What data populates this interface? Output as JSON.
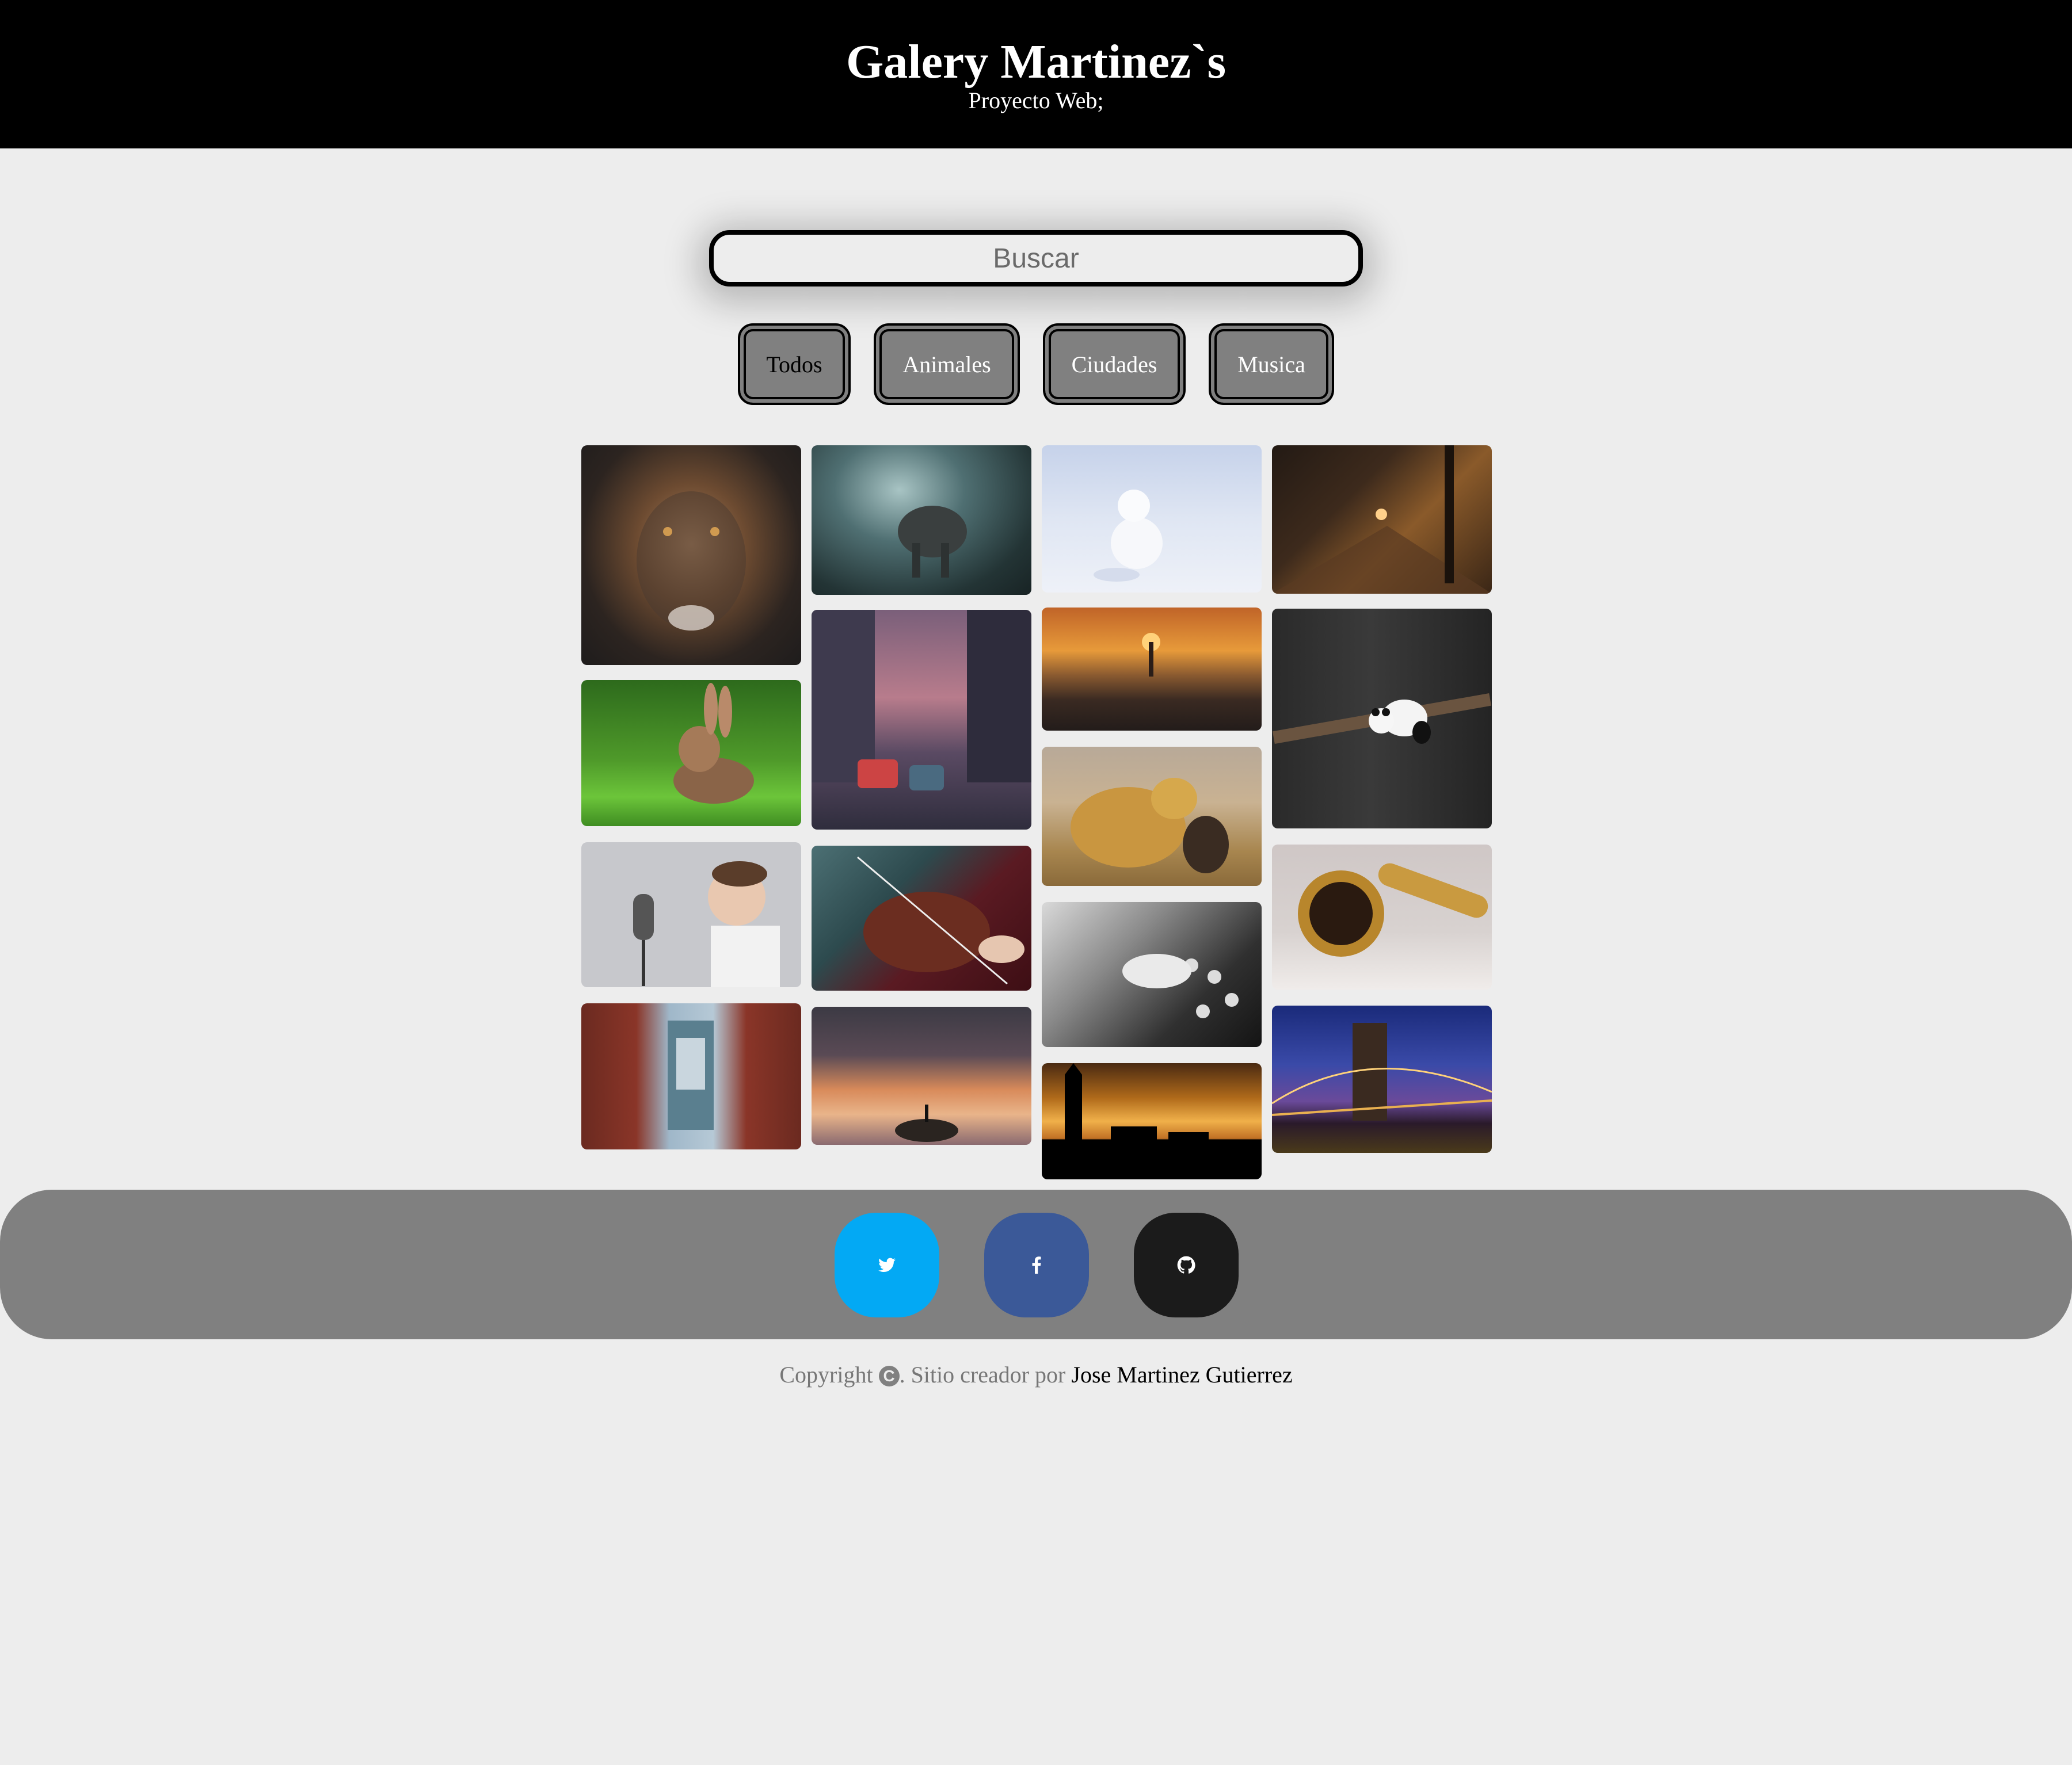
{
  "header": {
    "title": "Galery Martinez`s",
    "subtitle": "Proyecto Web;"
  },
  "search": {
    "placeholder": "Buscar"
  },
  "filters": [
    {
      "label": "Todos",
      "active": true
    },
    {
      "label": "Animales"
    },
    {
      "label": "Ciudades"
    },
    {
      "label": "Musica"
    }
  ],
  "gallery": {
    "columns": [
      [
        "lion",
        "rabbit",
        "boy-singing",
        "manhattan-bridge"
      ],
      [
        "elephant-forest",
        "city-traffic",
        "violin",
        "inverted-city-sunset"
      ],
      [
        "arctic-fox",
        "city-sunset-aerial",
        "lion-and-girl",
        "dj-mixer",
        "london-skyline-sunset"
      ],
      [
        "night-street",
        "panda",
        "saxophone",
        "brooklyn-bridge-night"
      ]
    ]
  },
  "social": [
    {
      "icon": "twitter-icon",
      "color": "#03a9f4"
    },
    {
      "icon": "facebook-icon",
      "color": "#3b5998"
    },
    {
      "icon": "github-icon",
      "color": "#1b1b1b"
    }
  ],
  "footer": {
    "copyright_prefix": "Copyright",
    "copyright_symbol": "C",
    "copyright_middle": ". Sitio creador por",
    "author": "Jose Martinez Gutierrez"
  }
}
